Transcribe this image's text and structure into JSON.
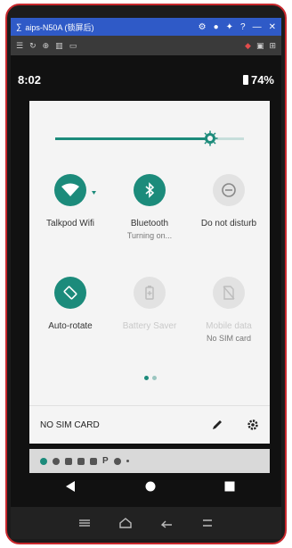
{
  "window": {
    "title": "aips-N50A (锁屏后)",
    "controls": [
      "⚙",
      "⏺",
      "📌",
      "?",
      "—",
      "✕"
    ]
  },
  "status_bar": {
    "time": "8:02",
    "battery": "74%"
  },
  "quick_settings": {
    "brightness": 0.82,
    "tiles": [
      {
        "label": "Talkpod Wifi",
        "sub": ""
      },
      {
        "label": "Bluetooth",
        "sub": "Turning on..."
      },
      {
        "label": "Do not disturb",
        "sub": ""
      },
      {
        "label": "Auto-rotate",
        "sub": ""
      },
      {
        "label": "Battery Saver",
        "sub": ""
      },
      {
        "label": "Mobile data",
        "sub": "No SIM card"
      }
    ],
    "footer_text": "NO SIM CARD"
  },
  "colors": {
    "accent": "#1c8b7b",
    "frame_border": "#c8282d",
    "titlebar": "#2f5ac7"
  }
}
